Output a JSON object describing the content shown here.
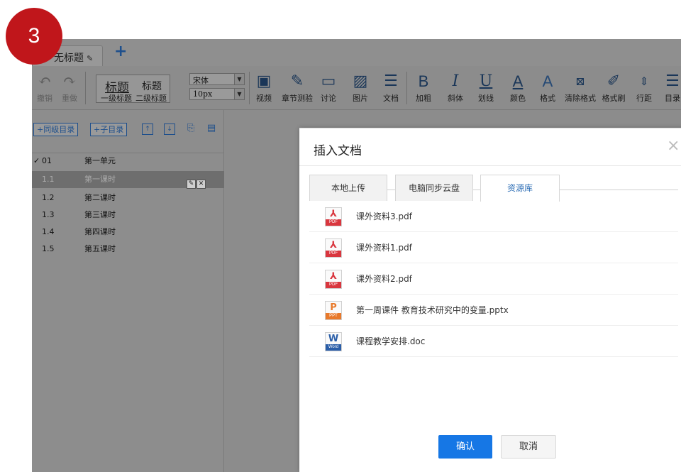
{
  "step_badge": "3",
  "tabbar": {
    "tab_title": "无标题",
    "add_label": "+"
  },
  "toolbar": {
    "undo": "撤销",
    "redo": "重做",
    "heading1_big": "标题",
    "heading2_big": "标题",
    "heading1_label": "一级标题",
    "heading2_label": "二级标题",
    "font_family": "宋体",
    "font_size": "10px",
    "video": "视频",
    "quiz": "章节测验",
    "discussion": "讨论",
    "image": "图片",
    "document": "文档",
    "bold": "加粗",
    "italic": "斜体",
    "underline": "划线",
    "color": "颜色",
    "format": "格式",
    "clear_format": "清除格式",
    "format_brush": "格式刷",
    "line_spacing": "行距",
    "toc": "目录",
    "bold_glyph": "B",
    "italic_glyph": "I",
    "underline_glyph": "U",
    "color_glyph": "A",
    "format_glyph": "A"
  },
  "sidebar": {
    "add_sibling": "+同级目录",
    "add_child": "+子目录",
    "tree": [
      {
        "num": "01",
        "name": "第一单元",
        "prefix": "✓"
      },
      {
        "num": "1.1",
        "name": "第一课时"
      },
      {
        "num": "1.2",
        "name": "第二课时"
      },
      {
        "num": "1.3",
        "name": "第三课时"
      },
      {
        "num": "1.4",
        "name": "第四课时"
      },
      {
        "num": "1.5",
        "name": "第五课时"
      }
    ]
  },
  "dialog": {
    "title": "插入文档",
    "close": "×",
    "tabs": [
      "本地上传",
      "电脑同步云盘",
      "资源库"
    ],
    "active_tab": "资源库",
    "files": [
      {
        "name": "课外资料3.pdf",
        "type": "PDF",
        "icon": "pdf-icon",
        "color": "#d9363e"
      },
      {
        "name": "课外资料1.pdf",
        "type": "PDF",
        "icon": "pdf-icon",
        "color": "#d9363e"
      },
      {
        "name": "课外资料2.pdf",
        "type": "PDF",
        "icon": "pdf-icon",
        "color": "#d9363e"
      },
      {
        "name": "第一周课件 教育技术研究中的变量.pptx",
        "type": "PPT",
        "icon": "ppt-icon",
        "color": "#e8792b"
      },
      {
        "name": "课程教学安排.doc",
        "type": "Word",
        "icon": "word-icon",
        "color": "#2b5ea8"
      }
    ],
    "confirm": "确认",
    "cancel": "取消"
  },
  "colors": {
    "badge": "#c0161b",
    "primary": "#1677e5",
    "overlay": "#8c8c8c"
  }
}
